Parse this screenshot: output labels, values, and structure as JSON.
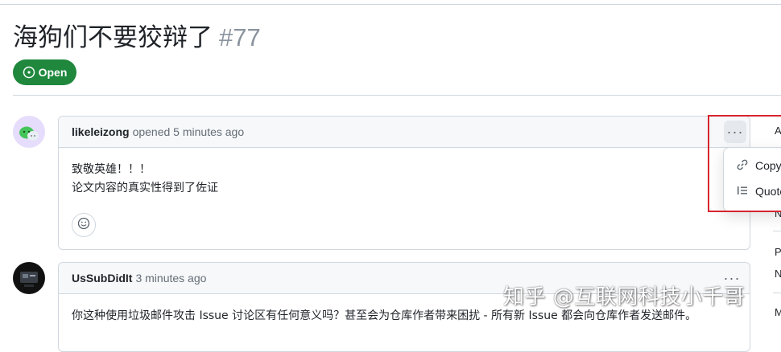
{
  "issue": {
    "title": "海狗们不要狡辩了",
    "number": "#77",
    "status_label": "Open",
    "status_color": "#1f883d"
  },
  "comments": [
    {
      "author": "likeleizong",
      "action": "opened 5 minutes ago",
      "body": [
        "致敬英雄！！！",
        "论文内容的真实性得到了佐证"
      ]
    },
    {
      "author": "UsSubDidIt",
      "action": "3 minutes ago",
      "body": [
        "你这种使用垃圾邮件攻击 Issue 讨论区有任何意义吗？甚至会为仓库作者带来困扰 - 所有新 Issue 都会向仓库作者发送邮件。"
      ]
    }
  ],
  "menu": {
    "copy_label": "Copy",
    "quote_label": "Quote"
  },
  "more_label": "···",
  "sidebar": {
    "letters": [
      "A",
      "N",
      "P",
      "N",
      "M"
    ]
  },
  "watermark": "知乎 @互联网科技小千哥",
  "colors": {
    "highlight": "#d6252e",
    "border": "#d0d7de",
    "header_bg": "#f6f8fa"
  }
}
